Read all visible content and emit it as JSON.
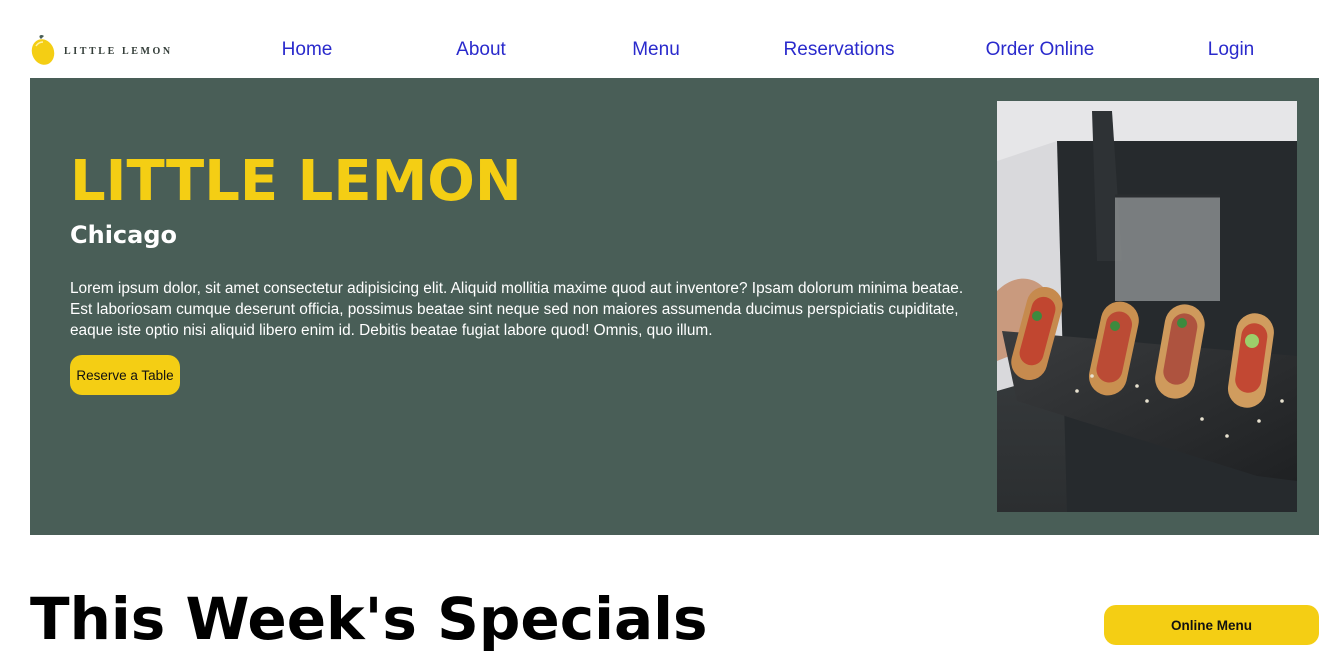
{
  "header": {
    "logo_text": "LITTLE LEMON",
    "logo_icon": "lemon-icon",
    "nav": [
      {
        "label": "Home"
      },
      {
        "label": "About"
      },
      {
        "label": "Menu"
      },
      {
        "label": "Reservations"
      },
      {
        "label": "Order Online"
      },
      {
        "label": "Login"
      }
    ]
  },
  "hero": {
    "title": "LITTLE LEMON",
    "subtitle": "Chicago",
    "description": "Lorem ipsum dolor, sit amet consectetur adipisicing elit. Aliquid mollitia maxime quod aut inventore? Ipsam dolorum minima beatae. Est laboriosam cumque deserunt officia, possimus beatae sint neque sed non maiores assumenda ducimus perspiciatis cupiditate, eaque iste optio nisi aliquid libero enim id. Debitis beatae fugiat labore quod! Omnis, quo illum.",
    "cta_label": "Reserve a Table"
  },
  "specials": {
    "title": "This Week's Specials",
    "button_label": "Online Menu"
  },
  "colors": {
    "brand_green": "#495e57",
    "brand_yellow": "#f4ce14",
    "nav_link": "#2a2acc"
  }
}
